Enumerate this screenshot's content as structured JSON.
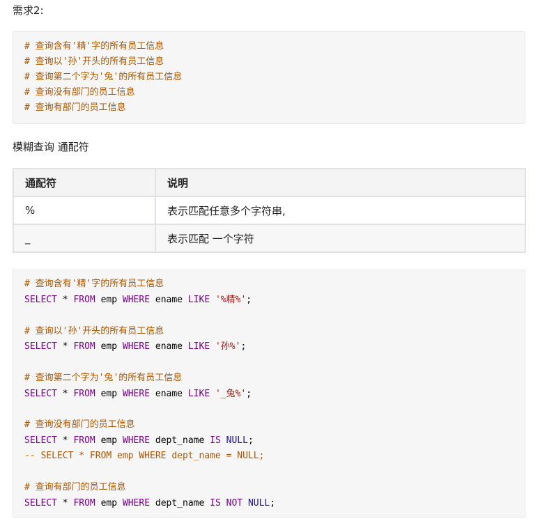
{
  "req_heading": "需求2:",
  "block1": {
    "lines": [
      "# 查询含有'精'字的所有员工信息",
      "# 查询以'孙'开头的所有员工信息",
      "# 查询第二个字为'兔'的所有员工信息",
      "# 查询没有部门的员工信息",
      "# 查询有部门的员工信息"
    ]
  },
  "section_heading": "模糊查询 通配符",
  "table": {
    "headers": [
      "通配符",
      "说明"
    ],
    "rows": [
      [
        "%",
        "表示匹配任意多个字符串,"
      ],
      [
        "_",
        "表示匹配 一个字符"
      ]
    ]
  },
  "block2": {
    "c1": "# 查询含有'精'字的所有员工信息",
    "q1": {
      "select": "SELECT",
      "star": " * ",
      "from": "FROM",
      "t": " emp ",
      "where": "WHERE",
      "col": " ename ",
      "like": "LIKE",
      "sp": " ",
      "str": "'%精%'",
      "end": ";"
    },
    "c2": "# 查询以'孙'开头的所有员工信息",
    "q2": {
      "select": "SELECT",
      "star": " * ",
      "from": "FROM",
      "t": " emp ",
      "where": "WHERE",
      "col": " ename ",
      "like": "LIKE",
      "sp": " ",
      "str": "'孙%'",
      "end": ";"
    },
    "c3": "# 查询第二个字为'兔'的所有员工信息",
    "q3": {
      "select": "SELECT",
      "star": " * ",
      "from": "FROM",
      "t": " emp ",
      "where": "WHERE",
      "col": " ename ",
      "like": "LIKE",
      "sp": " ",
      "str": "'_兔%'",
      "end": ";"
    },
    "c4": "# 查询没有部门的员工信息",
    "q4": {
      "select": "SELECT",
      "star": " * ",
      "from": "FROM",
      "t": " emp ",
      "where": "WHERE",
      "col": " dept_name ",
      "is": "IS",
      "sp": " ",
      "null": "NULL",
      "end": ";"
    },
    "q4b": "-- SELECT * FROM emp WHERE dept_name = NULL;",
    "c5": "# 查询有部门的员工信息",
    "q5": {
      "select": "SELECT",
      "star": " * ",
      "from": "FROM",
      "t": " emp ",
      "where": "WHERE",
      "col": " dept_name ",
      "is": "IS",
      "sp": " ",
      "not": "NOT",
      "sp2": " ",
      "null": "NULL",
      "end": ";"
    }
  },
  "colors": {
    "comment": "#aa5500",
    "keyword": "#770088",
    "string": "#aa1111",
    "atom": "#221199",
    "code_bg": "#f6f6f6"
  }
}
